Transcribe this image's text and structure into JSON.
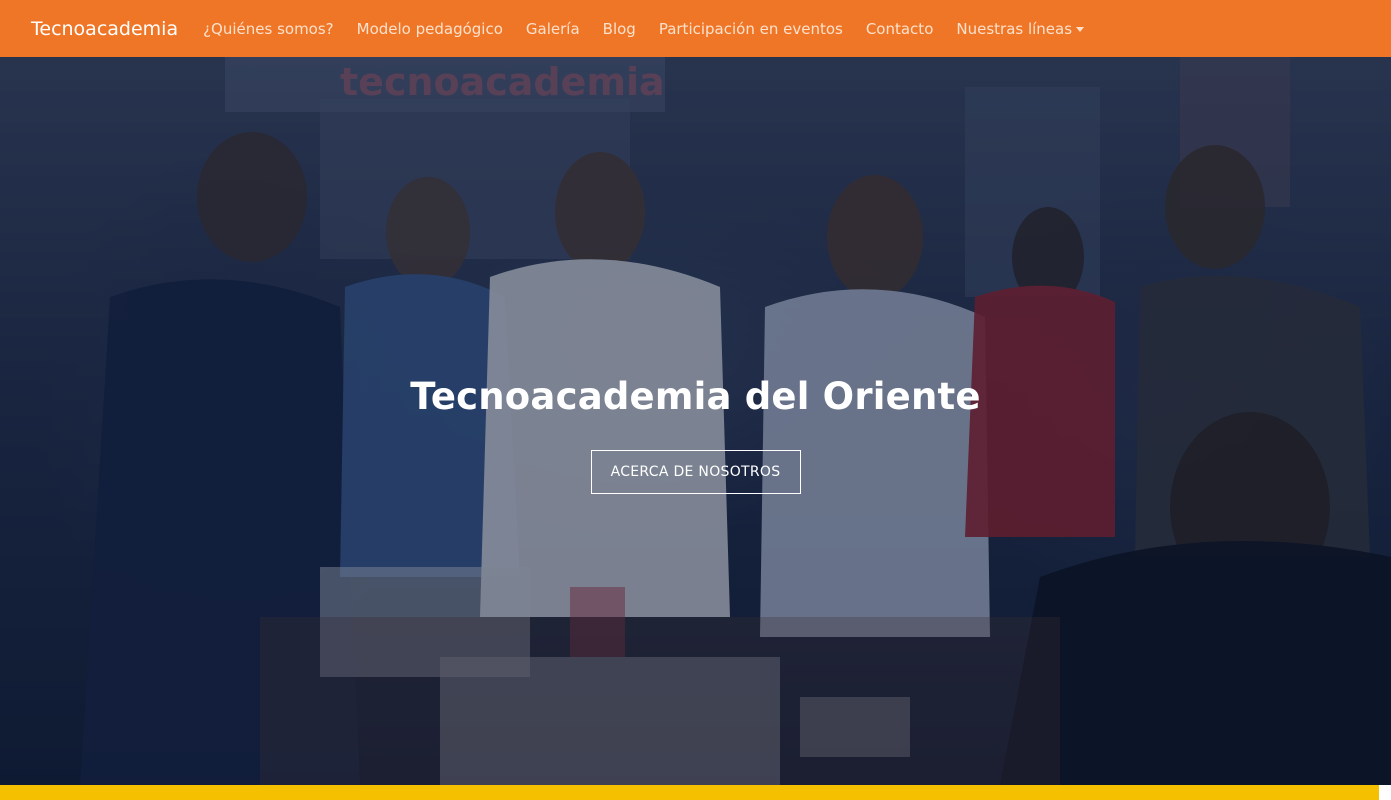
{
  "navbar": {
    "brand": "Tecnoacademia",
    "links": [
      {
        "label": "¿Quiénes somos?"
      },
      {
        "label": "Modelo pedagógico"
      },
      {
        "label": "Galería"
      },
      {
        "label": "Blog"
      },
      {
        "label": "Participación en eventos"
      },
      {
        "label": "Contacto"
      },
      {
        "label": "Nuestras líneas",
        "dropdown": true
      }
    ],
    "color": "#ef7626"
  },
  "hero": {
    "title": "Tecnoacademia del Oriente",
    "button_label": "ACERCA DE NOSOTROS",
    "background_image": "photo-of-group-of-people-in-masks-in-a-laboratory",
    "wall_sign": "tecnoacademia"
  },
  "footer_bar": {
    "color": "#f5c000"
  }
}
